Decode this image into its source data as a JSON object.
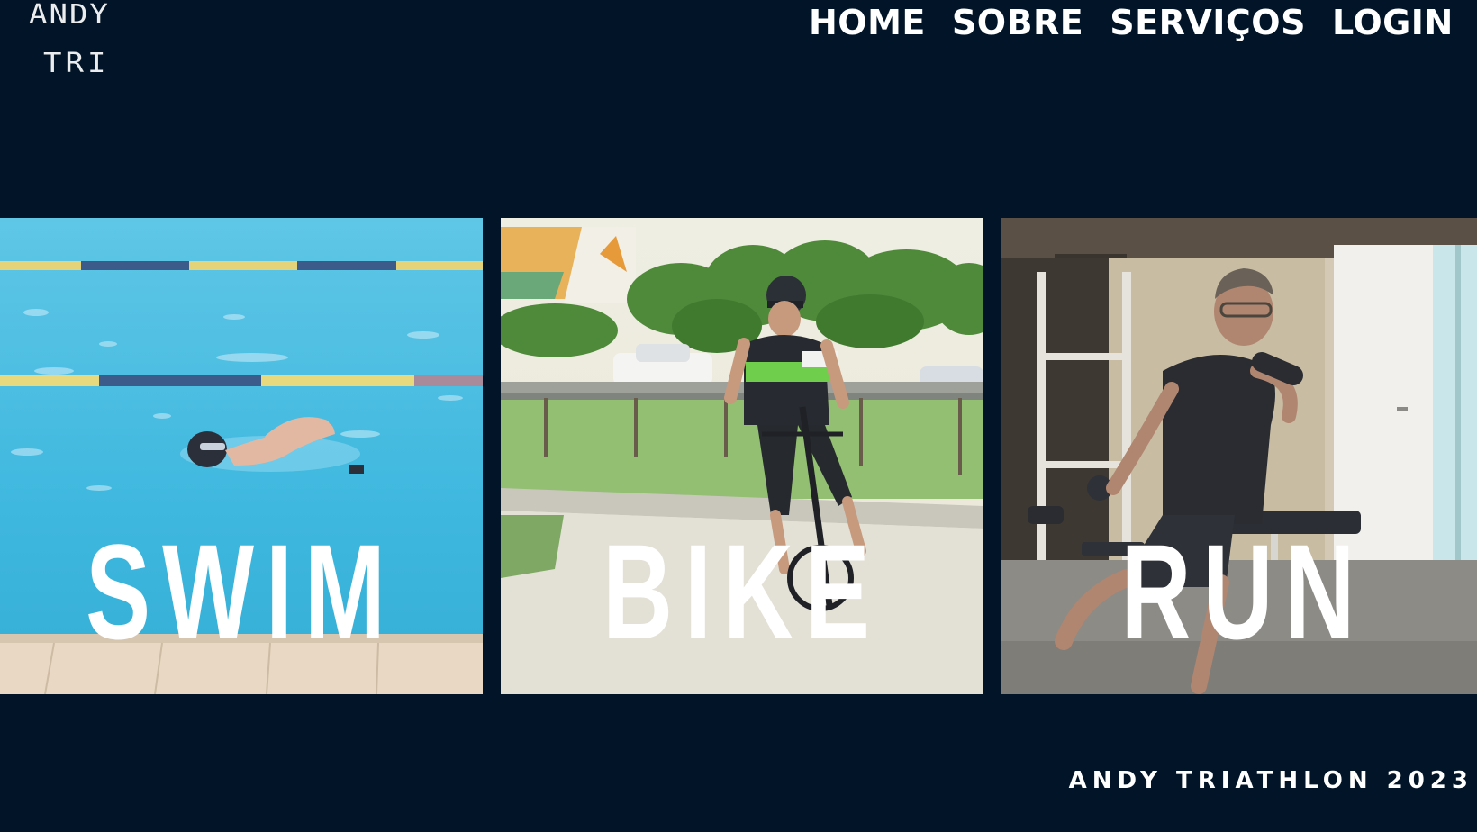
{
  "brand": {
    "line1": "ANDY",
    "line2": "TRI"
  },
  "nav": {
    "items": [
      "HOME",
      "SOBRE",
      "SERVIÇOS",
      "LOGIN"
    ]
  },
  "panels": [
    {
      "label": "SWIM",
      "image": "pool-swimmer-photo"
    },
    {
      "label": "BIKE",
      "image": "road-cyclist-photo"
    },
    {
      "label": "RUN",
      "image": "gym-runner-photo"
    }
  ],
  "footer": {
    "text": "ANDY TRIATHLON 2023"
  },
  "colors": {
    "background": "#021528",
    "text": "#ffffff",
    "pool": "#3bb6dd",
    "road": "#e8e6d8",
    "gym": "#b9ab92"
  }
}
